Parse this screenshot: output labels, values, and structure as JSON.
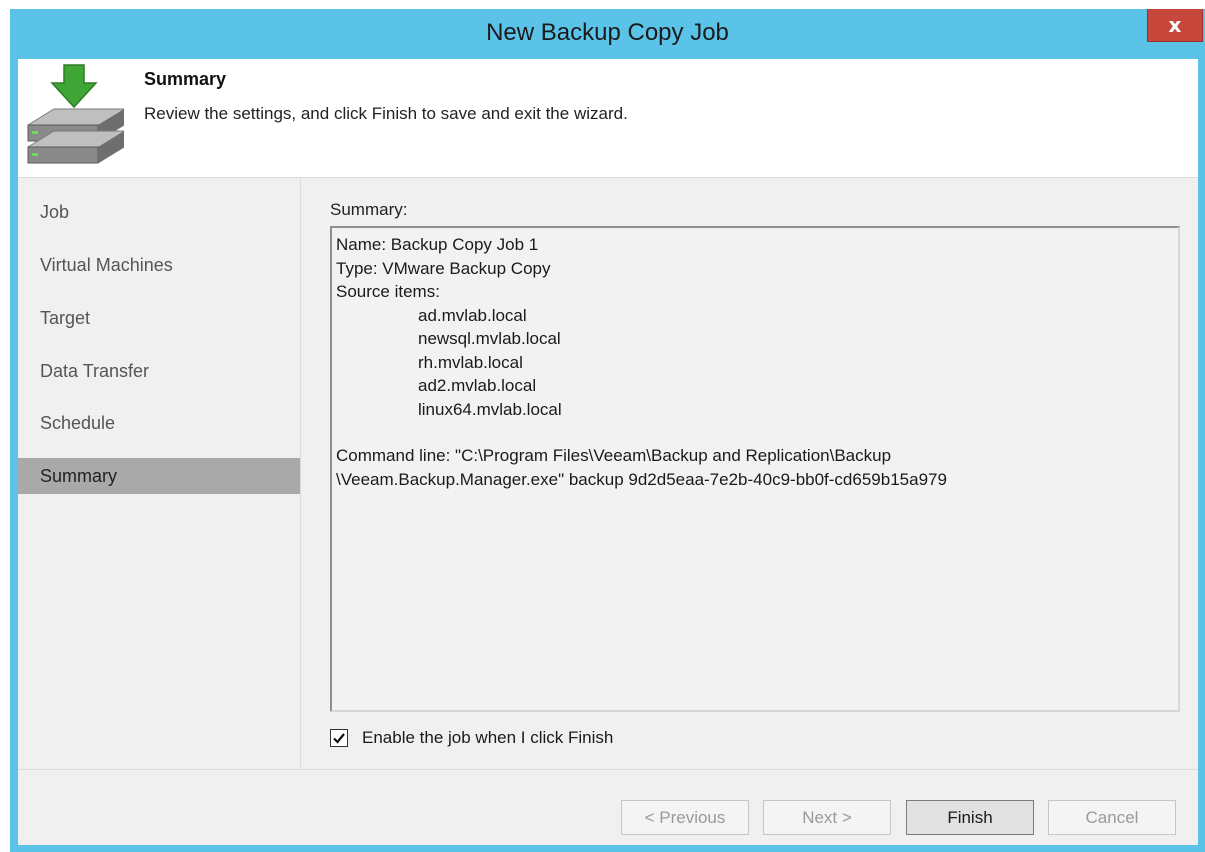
{
  "window": {
    "title": "New Backup Copy Job",
    "close_label": "x"
  },
  "header": {
    "title": "Summary",
    "subtitle": "Review the settings, and click Finish to save and exit the wizard."
  },
  "sidebar": {
    "items": [
      {
        "label": "Job"
      },
      {
        "label": "Virtual Machines"
      },
      {
        "label": "Target"
      },
      {
        "label": "Data Transfer"
      },
      {
        "label": "Schedule"
      },
      {
        "label": "Summary",
        "active": true
      }
    ]
  },
  "summary": {
    "label": "Summary:",
    "name_line": "Name: Backup Copy Job 1",
    "type_line": "Type: VMware Backup Copy",
    "source_label": "Source items:",
    "source_items": [
      "ad.mvlab.local",
      "newsql.mvlab.local",
      "rh.mvlab.local",
      "ad2.mvlab.local",
      "linux64.mvlab.local"
    ],
    "command_line_1": "Command line: \"C:\\Program Files\\Veeam\\Backup and Replication\\Backup",
    "command_line_2": "\\Veeam.Backup.Manager.exe\" backup 9d2d5eaa-7e2b-40c9-bb0f-cd659b15a979"
  },
  "options": {
    "enable_job_label": "Enable the job when I click Finish",
    "enable_job_checked": true
  },
  "buttons": {
    "previous": "< Previous",
    "next": "Next >",
    "finish": "Finish",
    "cancel": "Cancel"
  },
  "colors": {
    "titlebar": "#5bc3e8",
    "close": "#c8473c",
    "active_nav": "#a9a9a9",
    "icon_arrow": "#3fa535"
  }
}
